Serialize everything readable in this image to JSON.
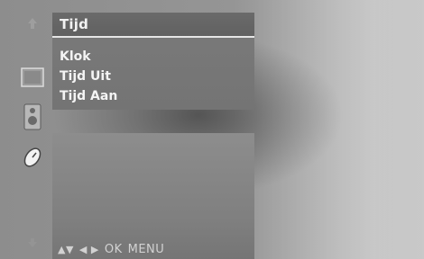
{
  "menu": {
    "title": "Tijd",
    "items": [
      {
        "label": "Klok"
      },
      {
        "label": "Tijd Uit"
      },
      {
        "label": "Tijd Aan"
      }
    ]
  },
  "sidebar": {
    "icons": [
      {
        "name": "up-arrow-icon"
      },
      {
        "name": "picture-icon"
      },
      {
        "name": "speaker-icon"
      },
      {
        "name": "clock-icon"
      },
      {
        "name": "down-arrow-icon"
      }
    ]
  },
  "nav_hint": {
    "updown": "▲▼",
    "leftright": "◀ ▶",
    "ok": "OK",
    "menu": "MENU"
  },
  "colors": {
    "text": "#f4f4f4",
    "panel": "#777777",
    "title_underline": "#e6e6e6"
  }
}
